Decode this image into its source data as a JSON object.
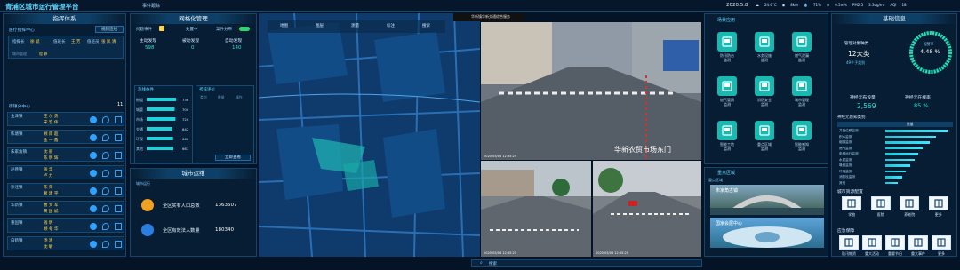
{
  "header": {
    "title": "青浦区城市运行管理平台",
    "center_label": "事件跟踪",
    "date": "2020.5.8",
    "weather": [
      {
        "label": "气温",
        "value": "24.6°C"
      },
      {
        "label": "能见度",
        "value": "8km"
      },
      {
        "label": "湿度",
        "value": "71%"
      },
      {
        "label": "风速",
        "value": "0.5m/s"
      },
      {
        "label": "PM2.5",
        "value": "3.3ug/m³"
      },
      {
        "label": "AQI",
        "value": "18"
      }
    ]
  },
  "command": {
    "title": "指挥体系",
    "center": "医疗指挥中心",
    "call_btn": "视频连线",
    "cols": [
      "指挥长",
      "值班长",
      "值班员"
    ],
    "names": [
      "徐 斌",
      "王 芳",
      "张 凤 清"
    ],
    "sub_label": "城市管理",
    "sub_names": [
      "程 静"
    ]
  },
  "units": {
    "title": "街镇分中心",
    "count": "11",
    "rows": [
      {
        "name": "金泽镇",
        "p1": "王 尔 勇",
        "p2": "宋 宏 伟"
      },
      {
        "name": "练塘镇",
        "p1": "顾 雨 超",
        "p2": "金 一 鑫"
      },
      {
        "name": "朱家角镇",
        "p1": "沈 丽",
        "p2": "陈 明 辉"
      },
      {
        "name": "赵巷镇",
        "p1": "张 华",
        "p2": "卢 力"
      },
      {
        "name": "徐泾镇",
        "p1": "陈 荣",
        "p2": "葛 建 平"
      },
      {
        "name": "华新镇",
        "p1": "曹 文 军",
        "p2": "黄 国 斌"
      },
      {
        "name": "重固镇",
        "p1": "钱 明",
        "p2": "顾 冬 华"
      },
      {
        "name": "白鹤镇",
        "p1": "汤 清",
        "p2": "沈 敏"
      }
    ]
  },
  "grid": {
    "title": "网格化管理",
    "tabs": [
      "问题事件",
      "处置中",
      "案件分布"
    ],
    "stats": [
      {
        "label": "主动发现",
        "value": "598"
      },
      {
        "label": "被动发现",
        "value": "0"
      },
      {
        "label": "自动发现",
        "value": "140"
      }
    ],
    "left_title": "热线办件",
    "left_bars": [
      {
        "label": "街道",
        "value": 736
      },
      {
        "label": "城管",
        "value": 700
      },
      {
        "label": "市场",
        "value": 720
      },
      {
        "label": "交通",
        "value": 642
      },
      {
        "label": "环保",
        "value": 660
      },
      {
        "label": "其他",
        "value": 667
      }
    ],
    "right_title": "考核评价",
    "right_cols": [
      "类别",
      "数量",
      "操作"
    ],
    "right_btn": "立即查看"
  },
  "ops": {
    "title": "城市运维",
    "subtitle": "城市运行",
    "items": [
      {
        "label": "全区实有人口总数",
        "value": "1363507"
      },
      {
        "label": "全区有效法人数量",
        "value": "180340"
      }
    ]
  },
  "map": {
    "tools": [
      "地图",
      "图层",
      "测量",
      "标注",
      "搜索"
    ]
  },
  "video": {
    "banner": "华新镇华新交通综合服务",
    "main_overlay": "华新农贸市场东门",
    "main_ts": "2020/05/08 12:35:25",
    "cams": [
      {
        "ts": "2020/05/08 12:35:25"
      },
      {
        "ts": "2020/05/08 12:35:25"
      }
    ],
    "search_placeholder": "搜索"
  },
  "scenes": {
    "title": "场景应用",
    "items": [
      {
        "label": "防汛防台\n监测",
        "color": "#18b9b1"
      },
      {
        "label": "水务设施\n监测",
        "color": "#18b9b1"
      },
      {
        "label": "燃气泄漏\n监测",
        "color": "#18b9b1"
      },
      {
        "label": "燃气管网\n监测",
        "color": "#18b9b1"
      },
      {
        "label": "消防安全\n监测",
        "color": "#18b9b1"
      },
      {
        "label": "城市管理\n监测",
        "color": "#18b9b1"
      },
      {
        "label": "智能工地\n监测",
        "color": "#18b9b1"
      },
      {
        "label": "重点区域\n监测",
        "color": "#18b9b1"
      },
      {
        "label": "智能感知\n监测",
        "color": "#18b9b1"
      }
    ]
  },
  "key_area": {
    "title": "重点区域",
    "items": [
      {
        "label": "朱家角古镇"
      },
      {
        "label": "国家会展中心"
      }
    ]
  },
  "basic": {
    "title": "基础信息",
    "sensor_label": "管理对象种类",
    "sensor_value": "12大类",
    "sensor_sub": "49个子类别",
    "gauge_value": "4.48 %",
    "gauge_label": "报警率",
    "online_label": "神经元布设量",
    "online_value": "2,569",
    "rate_label": "神经元在线率",
    "rate_value": "85 %",
    "list_title": "神经元感知类别",
    "list_header": "数量",
    "list": [
      {
        "name": "井盖位移监测",
        "value": 1200
      },
      {
        "name": "积水监测",
        "value": 980
      },
      {
        "name": "烟感监测",
        "value": 860
      },
      {
        "name": "燃气监测",
        "value": 720
      },
      {
        "name": "电梯运行监测",
        "value": 640
      },
      {
        "name": "水质监测",
        "value": 560
      },
      {
        "name": "噪音监测",
        "value": 480
      },
      {
        "name": "环境监测",
        "value": 400
      },
      {
        "name": "消防栓监测",
        "value": 320
      },
      {
        "name": "其他",
        "value": 240
      }
    ],
    "res_title": "城市资源配置",
    "res": [
      {
        "label": "学校"
      },
      {
        "label": "医院"
      },
      {
        "label": "养老院"
      },
      {
        "label": "更多"
      }
    ],
    "fac_title": "应急保障",
    "fac": [
      {
        "label": "防汛物资"
      },
      {
        "label": "重大活动"
      },
      {
        "label": "重要节日"
      },
      {
        "label": "重大事件"
      },
      {
        "label": "更多"
      }
    ]
  }
}
